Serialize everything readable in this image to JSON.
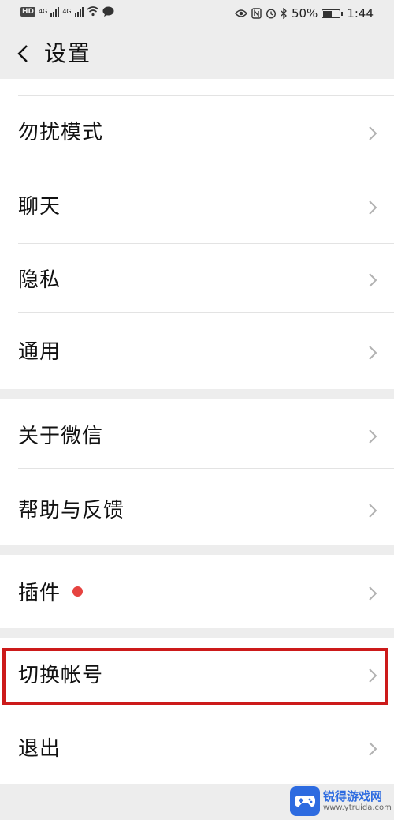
{
  "status_bar": {
    "left_badge": "HD",
    "network_1": "4G",
    "network_2": "4G",
    "battery_percent": "50%",
    "battery_level": 0.5,
    "time": "1:44"
  },
  "header": {
    "title": "设置"
  },
  "sections": [
    {
      "items": [
        {
          "label": "勿扰模式"
        },
        {
          "label": "聊天"
        },
        {
          "label": "隐私"
        },
        {
          "label": "通用"
        }
      ]
    },
    {
      "items": [
        {
          "label": "关于微信"
        },
        {
          "label": "帮助与反馈"
        }
      ]
    },
    {
      "items": [
        {
          "label": "插件",
          "badge": "red-dot"
        }
      ]
    },
    {
      "items": [
        {
          "label": "切换帐号",
          "highlighted": true
        },
        {
          "label": "退出"
        }
      ]
    }
  ],
  "colors": {
    "background": "#ededed",
    "card": "#ffffff",
    "badge_red": "#e64340",
    "highlight_border": "#cc1a1a",
    "chevron": "#b2b2b2"
  },
  "watermark": {
    "name": "锐得游戏网",
    "url": "www.ytruida.com"
  }
}
